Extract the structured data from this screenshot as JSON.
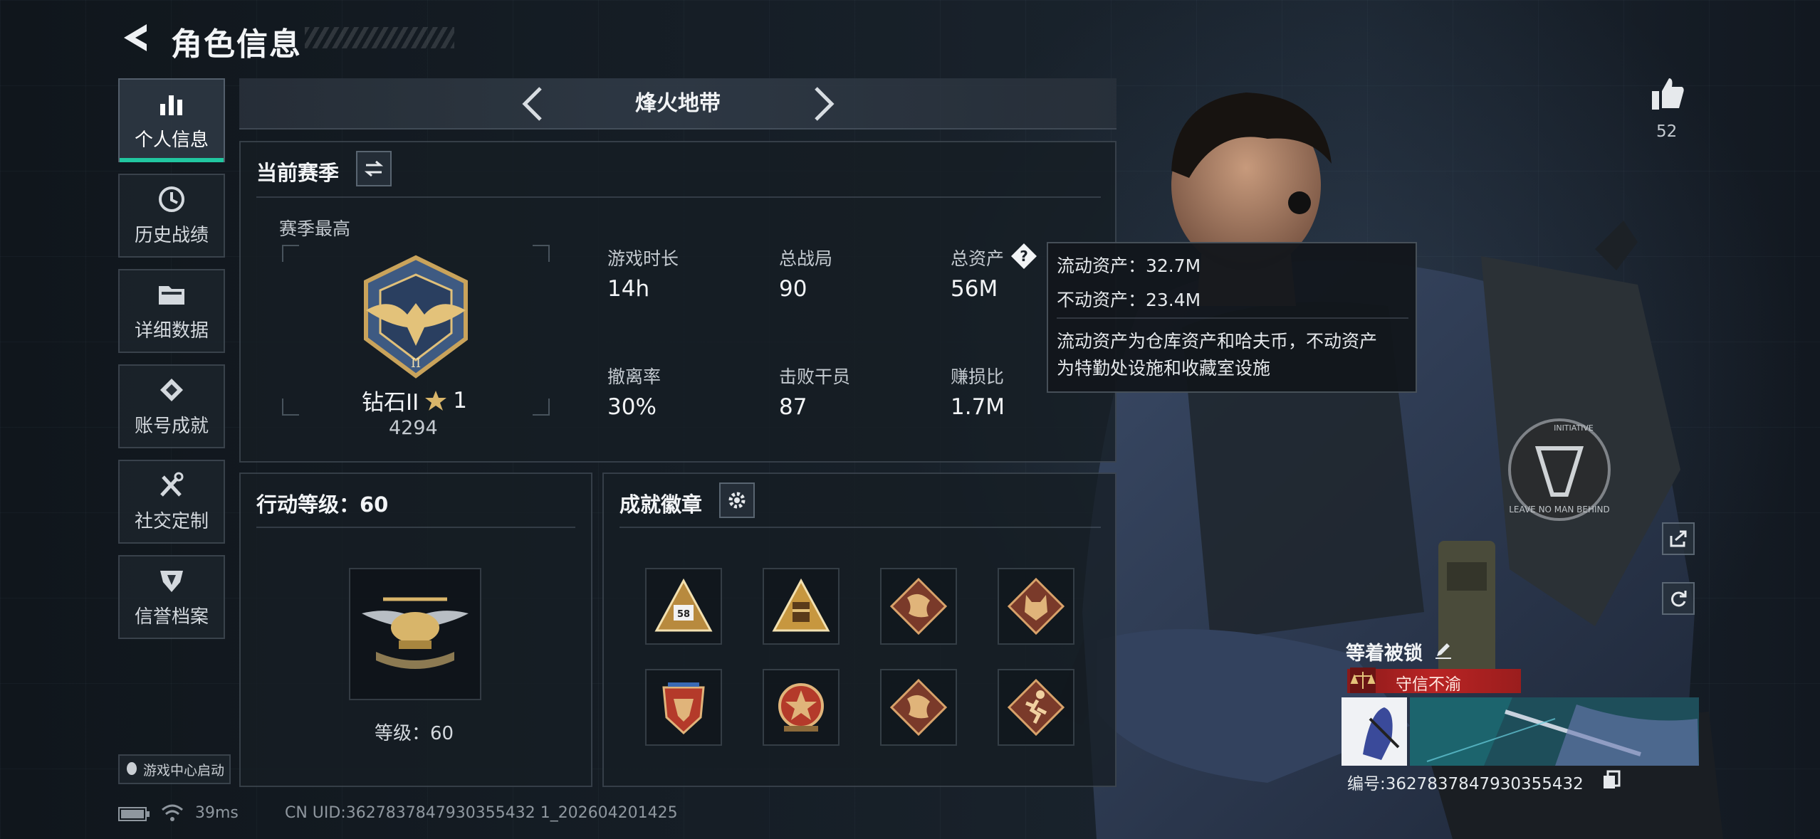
{
  "header": {
    "title": "角色信息"
  },
  "sidebar": {
    "items": [
      {
        "label": "个人信息",
        "icon": "bar-chart-icon",
        "active": true
      },
      {
        "label": "历史战绩",
        "icon": "clock-icon"
      },
      {
        "label": "详细数据",
        "icon": "folder-icon"
      },
      {
        "label": "账号成就",
        "icon": "achievement-icon"
      },
      {
        "label": "社交定制",
        "icon": "tools-icon"
      },
      {
        "label": "信誉档案",
        "icon": "shield-icon"
      }
    ],
    "launch_label": "游戏中心启动"
  },
  "mode_bar": {
    "name": "烽火地带"
  },
  "season": {
    "title": "当前赛季",
    "best_label": "赛季最高",
    "rank_name": "钻石II",
    "rank_stars": "1",
    "rank_score": "4294",
    "stats": [
      {
        "label": "游戏时长",
        "value": "14h"
      },
      {
        "label": "总战局",
        "value": "90"
      },
      {
        "label": "总资产",
        "value": "56M"
      },
      {
        "label": "撤离率",
        "value": "30%"
      },
      {
        "label": "击败干员",
        "value": "87"
      },
      {
        "label": "赚损比",
        "value": "1.7M"
      }
    ]
  },
  "tooltip": {
    "liquid": "流动资产：32.7M",
    "fixed": "不动资产：23.4M",
    "desc_line1": "流动资产为仓库资产和哈夫币，不动资产",
    "desc_line2": "为特勤处设施和收藏室设施"
  },
  "action_level": {
    "title": "行动等级：60",
    "level_label": "等级：60",
    "level_value": 60
  },
  "achievements": {
    "title": "成就徽章",
    "badges": [
      {
        "icon": "triangle-badge-58-icon",
        "label": "58"
      },
      {
        "icon": "triangle-badge-box-icon"
      },
      {
        "icon": "dragon-badge-icon"
      },
      {
        "icon": "wolf-badge-icon"
      },
      {
        "icon": "eagle-shield-badge-icon"
      },
      {
        "icon": "star-emblem-badge-icon"
      },
      {
        "icon": "dragon-badge-icon"
      },
      {
        "icon": "runner-badge-icon"
      }
    ]
  },
  "likes": {
    "count": "52"
  },
  "player": {
    "name": "等着被锁",
    "title_tag": "守信不渝",
    "uid_label": "编号:3627837847930355432",
    "patch_text": "LEAVE NO MAN BEHIND",
    "patch_top": "INITIATIVE"
  },
  "status_bar": {
    "ping": "39ms",
    "uid": "CN UID:3627837847930355432 1_202604201425"
  },
  "colors": {
    "accent": "#21c6a0",
    "gold": "#d8b56a",
    "title_red": "#b92424"
  }
}
